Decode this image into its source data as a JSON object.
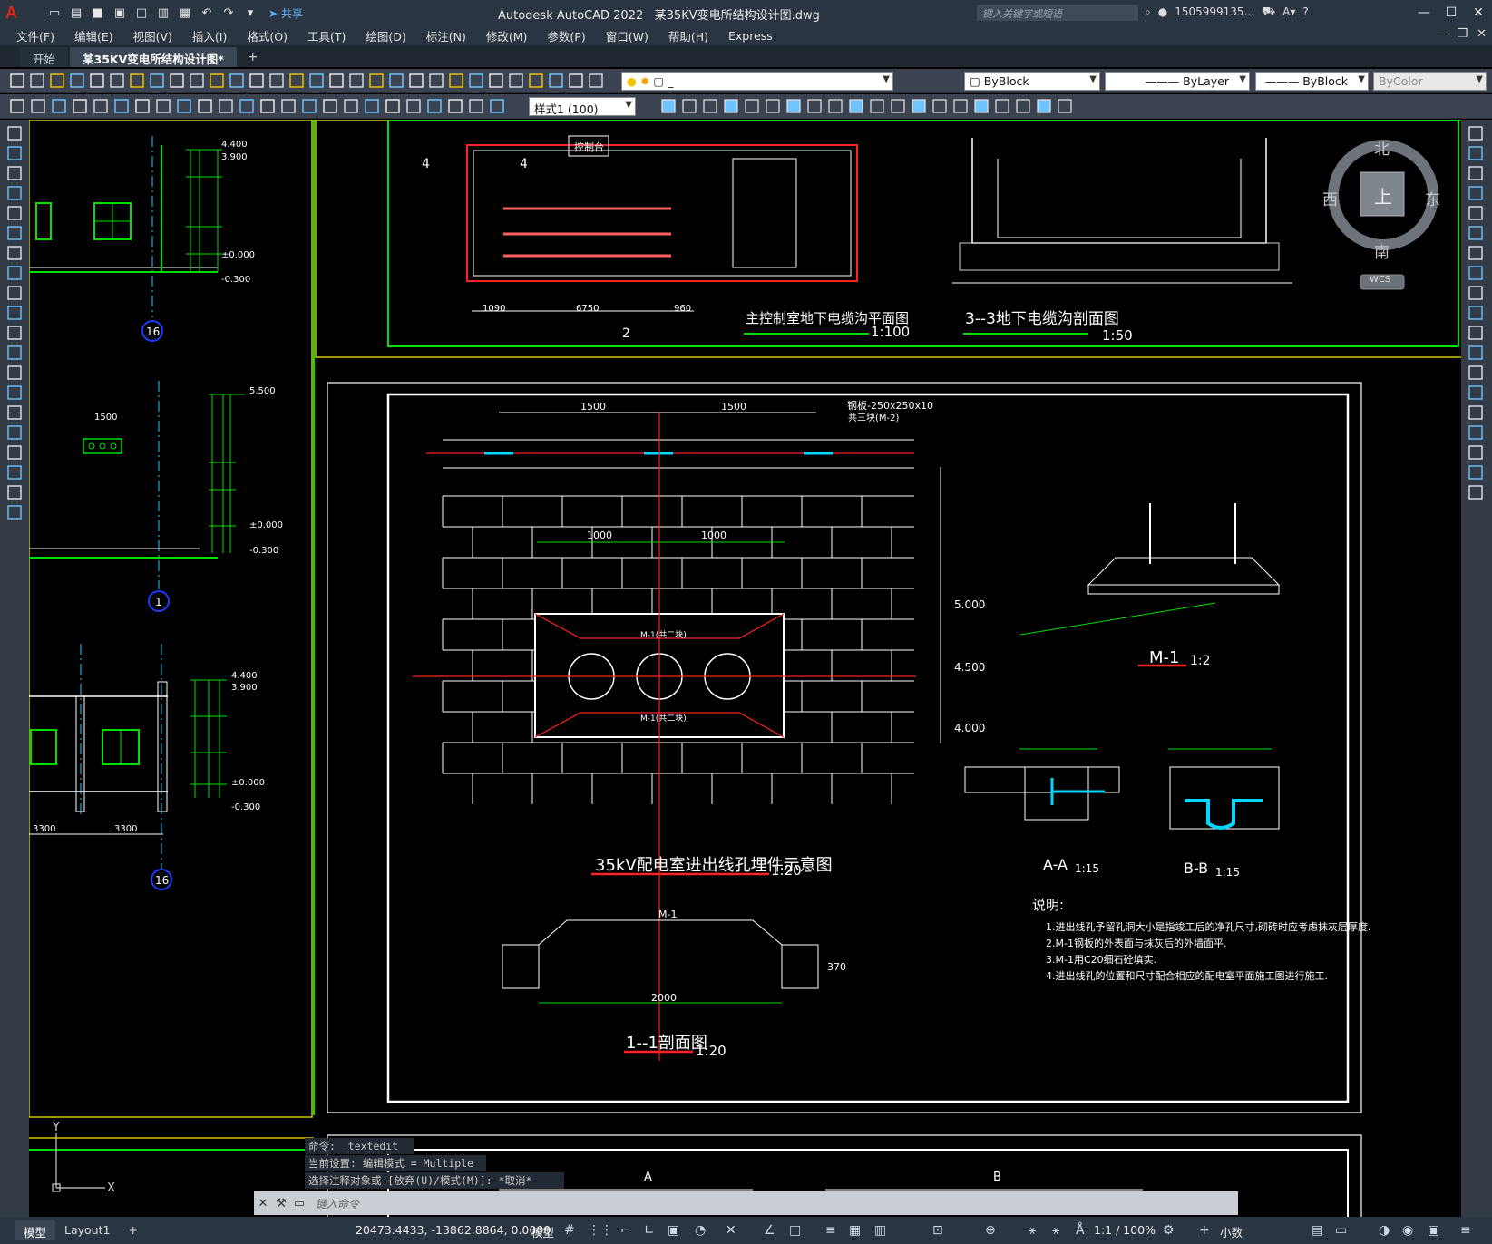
{
  "window": {
    "app_title": "Autodesk AutoCAD 2022",
    "file_title": "某35KV变电所结构设计图.dwg",
    "share_label": "共享",
    "search_placeholder": "键入关键字或短语",
    "user_id": "1505999135...",
    "help": "?"
  },
  "menu": [
    "文件(F)",
    "编辑(E)",
    "视图(V)",
    "插入(I)",
    "格式(O)",
    "工具(T)",
    "绘图(D)",
    "标注(N)",
    "修改(M)",
    "参数(P)",
    "窗口(W)",
    "帮助(H)",
    "Express"
  ],
  "tabs": {
    "start": "开始",
    "active": "某35KV变电所结构设计图*",
    "add": "+"
  },
  "toolbar": {
    "layer_name": "_",
    "color": "ByBlock",
    "linetype": "ByLayer",
    "lineweight": "ByBlock",
    "plotstyle": "ByColor",
    "dimstyle": "样式1 (100)"
  },
  "viewcube": {
    "north": "北",
    "south": "南",
    "east": "东",
    "west": "西",
    "top": "上",
    "wcs": "WCS"
  },
  "drawing": {
    "plan_title": "主控制室地下电缆沟平面图",
    "plan_scale": "1:100",
    "section33_title": "3--3地下电缆沟剖面图",
    "section33_scale": "1:50",
    "main_title": "35kV配电室进出线孔埋件示意图",
    "main_scale": "1:20",
    "section11_title": "1--1剖面图",
    "section11_scale": "1:20",
    "m1_title": "M-1",
    "m1_scale": "1:2",
    "aa_title": "A-A",
    "aa_scale": "1:15",
    "bb_title": "B-B",
    "bb_scale": "1:15",
    "notes_title": "说明:",
    "notes": [
      "1.进出线孔予留孔洞大小是指竣工后的净孔尺寸,砌砖时应考虑抹灰层厚度.",
      "2.M-1钢板的外表面与抹灰后的外墙面平.",
      "3.M-1用C20细石砼填实.",
      "4.进出线孔的位置和尺寸配合相应的配电室平面施工图进行施工."
    ],
    "control_box": "控制台",
    "dims_1500": "1500",
    "dims_1000": "1000",
    "dim_2000": "2000",
    "dim_370": "370",
    "elev_5000": "5.000",
    "elev_4500": "4.500",
    "elev_4000": "4.000",
    "elev_4400": "4.400",
    "elev_3900": "3.900",
    "elev_000": "±0.000",
    "elev_m300": "-0.300",
    "elev_5500": "5.500",
    "axis_16": "16",
    "axis_1": "1",
    "dim_3300": "3300",
    "steel_plate": "钢板-250x250x10",
    "steel_count": "共三块(M-2)",
    "m1_top": "M-1(共二块)",
    "m1_bottom": "M-1(共二块)",
    "dim_6750": "6750",
    "dim_1090": "1090",
    "dim_960": "960"
  },
  "command": {
    "line1": "命令: _textedit",
    "line2": "当前设置: 编辑模式 = Multiple",
    "line3": "选择注释对象或 [放弃(U)/模式(M)]: *取消*",
    "input_placeholder": "键入命令"
  },
  "status": {
    "model_tab": "模型",
    "layout_tab": "Layout1",
    "add_tab": "+",
    "coordinates": "20473.4433, -13862.8864, 0.0000",
    "space": "模型",
    "annotation_scale": "1:1 / 100%",
    "units": "小数"
  }
}
